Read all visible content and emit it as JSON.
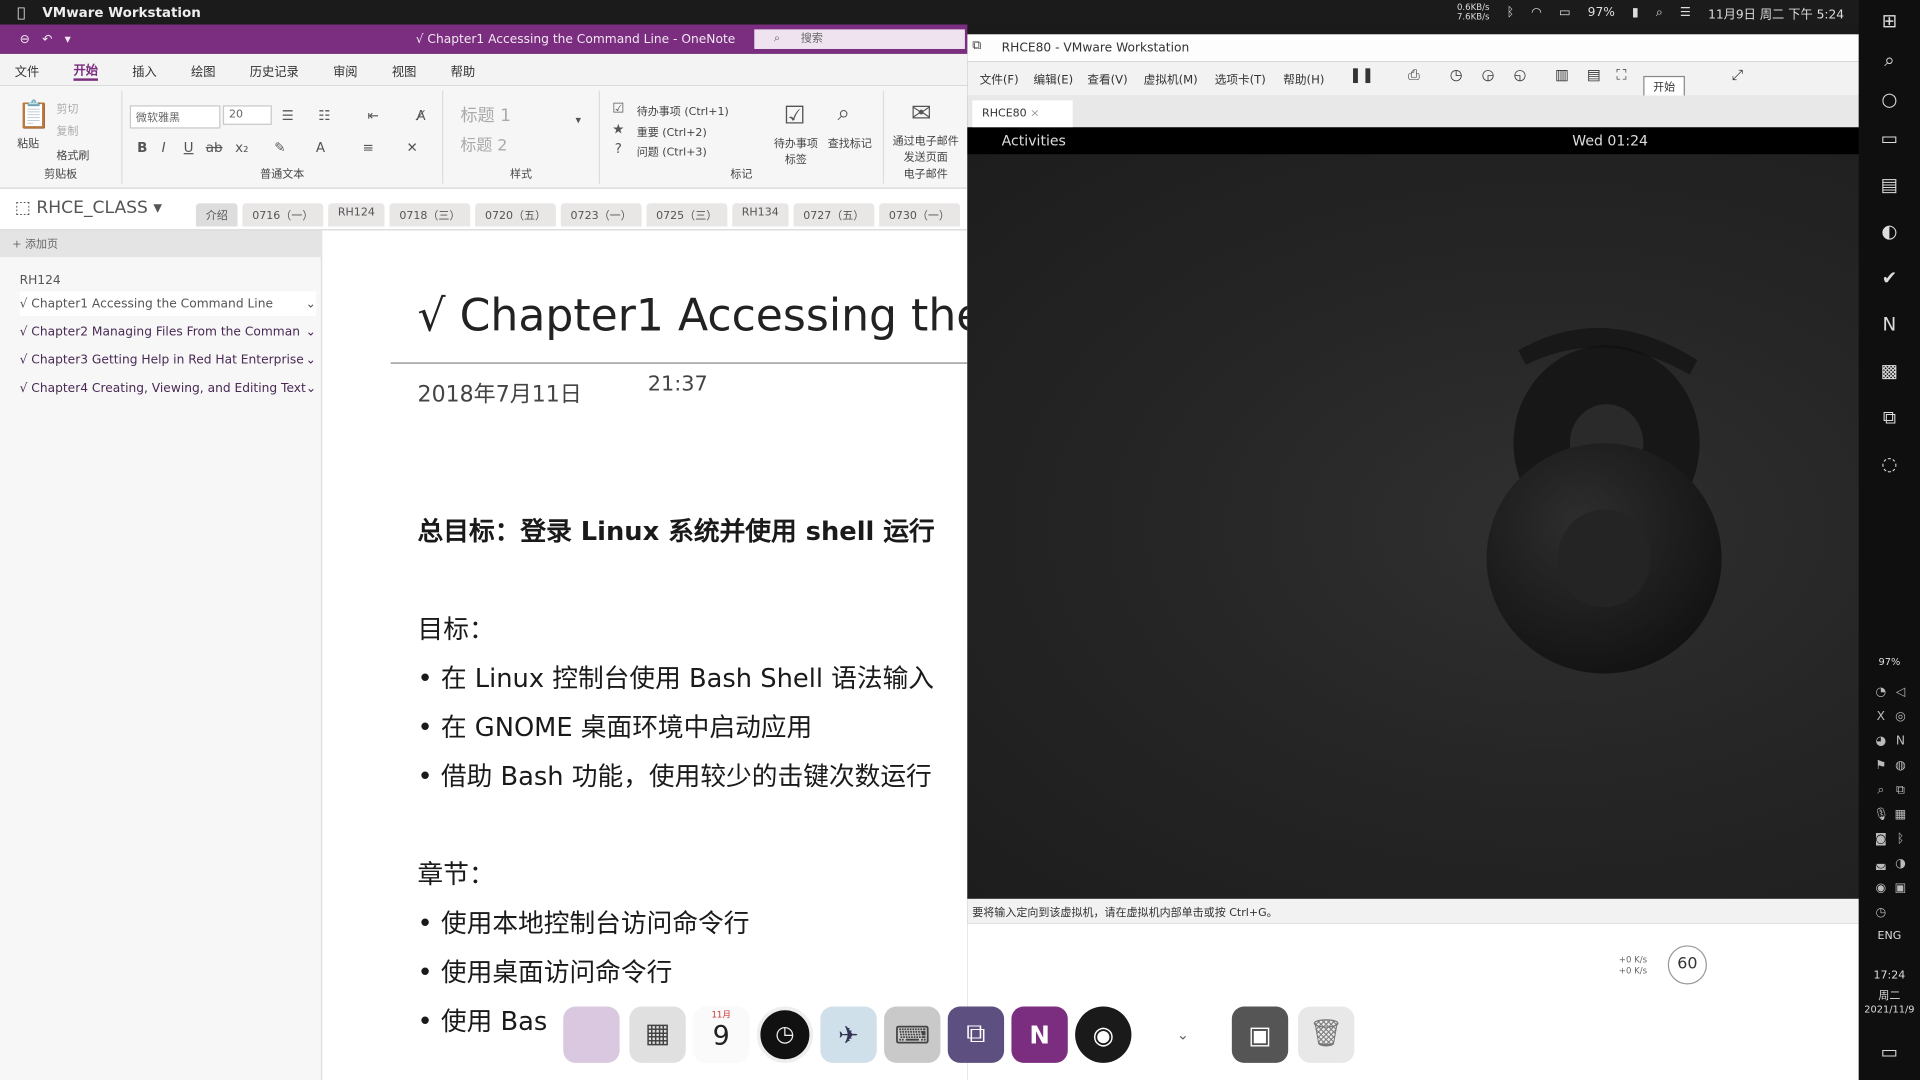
{
  "menubar": {
    "app": "VMware Workstation",
    "net_up": "0.6KB/s",
    "net_down": "7.6KB/s",
    "battery": "97%",
    "datetime": "11月9日 周二 下午 5:24"
  },
  "onenote": {
    "title": "√ Chapter1 Accessing the Command Line  -  OneNote",
    "search_placeholder": "搜索",
    "tabs": [
      "文件",
      "开始",
      "插入",
      "绘图",
      "历史记录",
      "审阅",
      "视图",
      "帮助"
    ],
    "ribbon": {
      "clipboard": {
        "paste": "粘贴",
        "cut": "剪切",
        "copy": "复制",
        "format_painter": "格式刷",
        "label": "剪贴板"
      },
      "font": {
        "font_name": "微软雅黑",
        "size": "20",
        "label": "普通文本"
      },
      "styles": {
        "h1": "标题 1",
        "h2": "标题 2",
        "label": "样式"
      },
      "tags": {
        "todo": "待办事项 (Ctrl+1)",
        "important": "重要 (Ctrl+2)",
        "question": "问题 (Ctrl+3)",
        "todo_tag": "待办事项标签",
        "find_tags": "查找标记",
        "label": "标记"
      },
      "email": {
        "send": "通过电子邮件发送页面",
        "label": "电子邮件"
      }
    },
    "notebook": "RHCE_CLASS",
    "sections": [
      "介绍",
      "0716（一）",
      "RH124",
      "0718（三）",
      "0720（五）",
      "0723（一）",
      "0725（三）",
      "RH134",
      "0727（五）",
      "0730（一）"
    ],
    "add_page": "+ 添加页",
    "section_head": "RH124",
    "pages": [
      "√ Chapter1 Accessing the Command Line",
      "√ Chapter2 Managing Files From the Comman",
      "√ Chapter3 Getting Help in Red Hat Enterprise",
      "√ Chapter4 Creating, Viewing, and Editing Text"
    ],
    "page": {
      "title": "√ Chapter1 Accessing the",
      "date": "2018年7月11日",
      "time": "21:37",
      "lines": [
        "总目标：登录 Linux 系统并使用 shell 运行",
        "目标：",
        "• 在 Linux 控制台使用 Bash Shell 语法输入",
        "• 在 GNOME 桌面环境中启动应用",
        "• 借助 Bash 功能，使用较少的击键次数运行",
        "章节：",
        "• 使用本地控制台访问命令行",
        "• 使用桌面访问命令行",
        "• 使用 Bas"
      ]
    }
  },
  "vmware": {
    "title": "RHCE80 - VMware Workstation",
    "menu": [
      "文件(F)",
      "编辑(E)",
      "查看(V)",
      "虚拟机(M)",
      "选项卡(T)",
      "帮助(H)"
    ],
    "start_button": "开始",
    "tab": "RHCE80",
    "gnome": {
      "activities": "Activities",
      "clock": "Wed 01:24"
    },
    "status": "要将输入定向到该虚拟机，请在虚拟机内部单击或按 Ctrl+G。"
  },
  "dock": {
    "calendar_month": "11月",
    "calendar_day": "9"
  },
  "progress_circle": "60",
  "sidebar": {
    "battery": "97%",
    "lang": "ENG",
    "clock": "17:24",
    "weekday": "周二",
    "date": "2021/11/9"
  },
  "colors": {
    "onenote_purple": "#7b2d7f",
    "guest_bg": "#262626",
    "menubar": "#1b1b1b"
  }
}
